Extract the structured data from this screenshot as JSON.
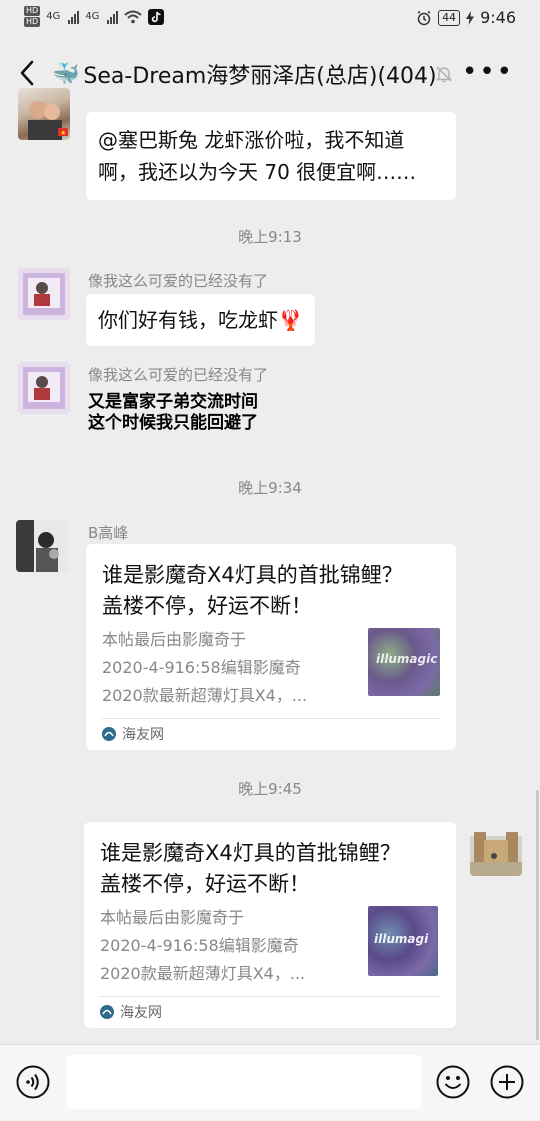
{
  "status_bar": {
    "hd1": "HD",
    "hd2": "HD",
    "net1": "4G",
    "net2": "4G",
    "battery": "44",
    "time": "9:46"
  },
  "nav": {
    "title_emoji": "🐳",
    "title": "Sea-Dream海梦丽泽店(总店)(404)"
  },
  "messages": {
    "m1": {
      "line1": "@塞巴斯兔  龙虾涨价啦，我不知道",
      "line2": "啊，我还以为今天 70 很便宜啊……"
    },
    "time1": "晚上9:13",
    "m2": {
      "sender": "像我这么可爱的已经没有了",
      "text": "你们好有钱，吃龙虾🦞"
    },
    "m3": {
      "sender": "像我这么可爱的已经没有了",
      "line1": "又是富家子弟交流时间",
      "line2": "这个时候我只能回避了"
    },
    "time2": "晚上9:34",
    "m4": {
      "sender": "B高峰",
      "title_line1": "谁是影魔奇X4灯具的首批锦鲤？",
      "title_line2": "盖楼不停，好运不断！",
      "desc": [
        "本帖最后由影魔奇于",
        "2020-4-916:58编辑影魔奇",
        "2020款最新超薄灯具X4，..."
      ],
      "thumb_text": "illumagic",
      "source": "海友网"
    },
    "time3": "晚上9:45",
    "m5": {
      "title_line1": "谁是影魔奇X4灯具的首批锦鲤？",
      "title_line2": "盖楼不停，好运不断！",
      "desc": [
        "本帖最后由影魔奇于",
        "2020-4-916:58编辑影魔奇",
        "2020款最新超薄灯具X4，..."
      ],
      "thumb_text": "illumagi",
      "source": "海友网"
    }
  },
  "input_bar": {
    "value": ""
  },
  "icons": {
    "back": "back-arrow-icon",
    "mute": "mute-bell-icon",
    "more": "more-icon",
    "voice": "voice-icon",
    "emoji": "emoji-icon",
    "plus": "plus-icon"
  },
  "colors": {
    "background": "#ededed",
    "bubble": "#ffffff",
    "meta": "#888888"
  }
}
